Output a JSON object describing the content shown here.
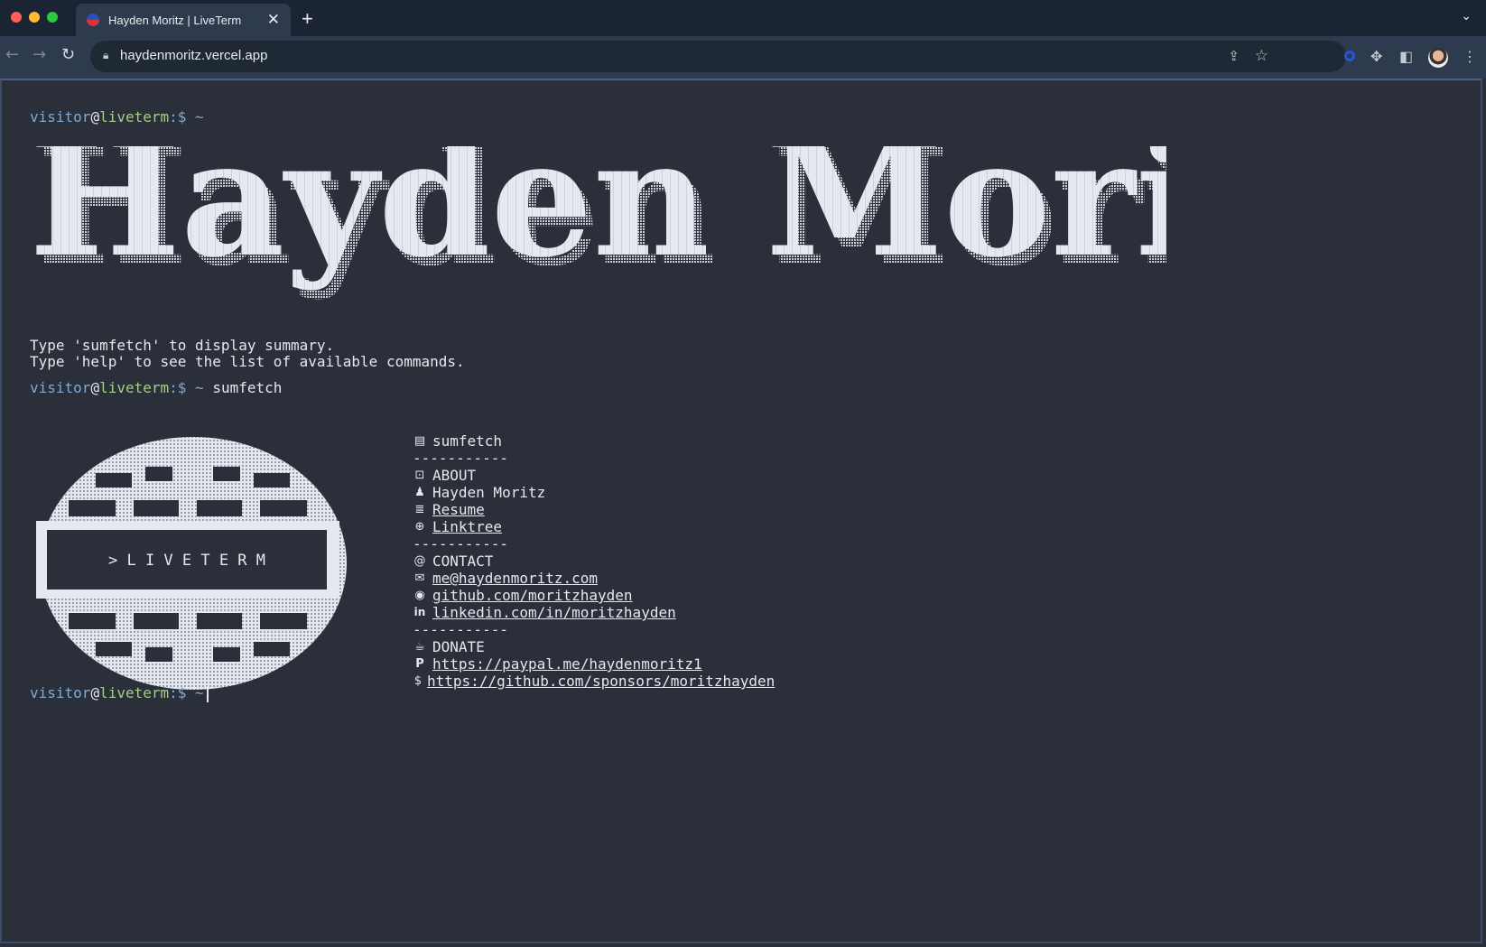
{
  "browser": {
    "tab_title": "Hayden Moritz | LiveTerm",
    "url": "haydenmoritz.vercel.app"
  },
  "prompt": {
    "user": "visitor",
    "at": "@",
    "host": "liveterm",
    "symbol": ":$",
    "tilde": "~"
  },
  "banner_text": "Hayden Moritz",
  "welcome": {
    "line1": "Type 'sumfetch' to display summary.",
    "line2": "Type 'help' to see the list of available commands."
  },
  "command_entered": "sumfetch",
  "logo_text": "> L I V E T E R M",
  "sumfetch": {
    "header": "sumfetch",
    "divider": "-----------",
    "about_title": "ABOUT",
    "name": "Hayden Moritz",
    "resume": "Resume",
    "linktree": "Linktree",
    "divider2": "-----------",
    "contact_title": "CONTACT",
    "email": "me@haydenmoritz.com",
    "github": "github.com/moritzhayden",
    "linkedin": "linkedin.com/in/moritzhayden",
    "divider3": "-----------",
    "donate_title": "DONATE",
    "paypal": "https://paypal.me/haydenmoritz1",
    "sponsors": "https://github.com/sponsors/moritzhayden"
  },
  "colors": {
    "background": "#2a2f3a",
    "user": "#7eaad4",
    "host": "#a8cc8c",
    "text": "#e6e8ee"
  }
}
